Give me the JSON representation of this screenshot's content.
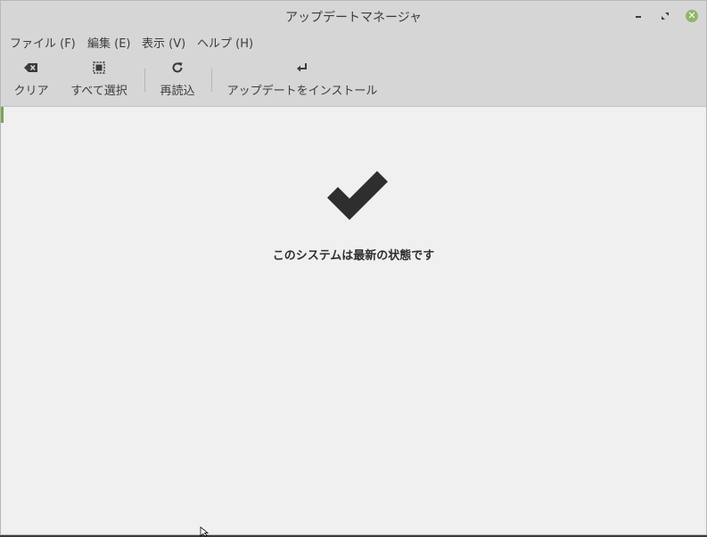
{
  "window": {
    "title": "アップデートマネージャ"
  },
  "menu": {
    "items": [
      {
        "label": "ファイル (F)"
      },
      {
        "label": "編集 (E)"
      },
      {
        "label": "表示 (V)"
      },
      {
        "label": "ヘルプ (H)"
      }
    ]
  },
  "toolbar": {
    "clear_label": "クリア",
    "select_all_label": "すべて選択",
    "refresh_label": "再読込",
    "install_label": "アップデートをインストール"
  },
  "status": {
    "message": "このシステムは最新の状態です"
  },
  "colors": {
    "close_button": "#8fb769",
    "chrome": "#d6d6d6",
    "background": "#f0f0f0"
  },
  "icons": [
    "backspace-icon",
    "select-all-icon",
    "refresh-icon",
    "return-arrow-icon",
    "checkmark-icon"
  ]
}
